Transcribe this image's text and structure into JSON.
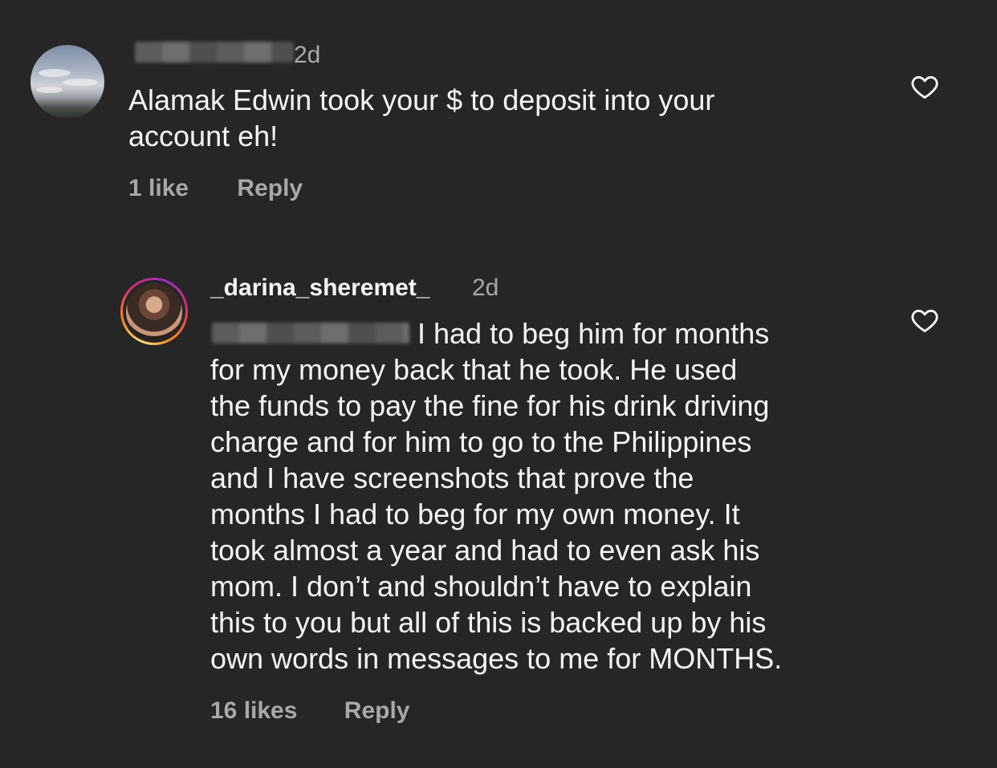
{
  "comments": [
    {
      "username_redacted": true,
      "time": "2d",
      "text": "Alamak Edwin took your $ to deposit into your\naccount eh!",
      "likes": "1 like",
      "reply": "Reply",
      "icon": "heart-outline-icon"
    },
    {
      "username": "_darina_sheremet_",
      "time": "2d",
      "mention_redacted": true,
      "text": "I had to beg him for months\nfor my money back that he took. He used\nthe funds to pay the fine for his drink driving\ncharge and for him to go to the Philippines\nand I have screenshots that prove the\nmonths I had to beg for my own money. It\ntook almost a year and had to even ask his\nmom. I don’t and shouldn’t have to explain\nthis to you but all of this is backed up by his\nown words in messages to me for MONTHS.",
      "likes": "16 likes",
      "reply": "Reply",
      "icon": "heart-outline-icon"
    }
  ],
  "colors": {
    "background": "#262626",
    "primary_text": "#f5f5f5",
    "secondary_text": "#a8a8a8"
  }
}
